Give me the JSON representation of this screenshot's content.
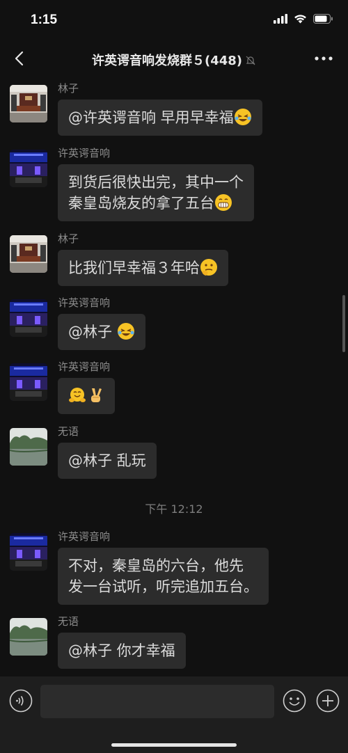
{
  "status_bar": {
    "time": "1:15"
  },
  "nav": {
    "title": "许英谔音响发烧群５(448)"
  },
  "messages": [
    {
      "sender": "林子",
      "text": "@许英谔音响 早用早幸福",
      "emoji": "laughing-tears"
    },
    {
      "sender": "许英谔音响",
      "text": "到货后很快出完，其中一个\n秦皇岛烧友的拿了五台",
      "emoji": "grin"
    },
    {
      "sender": "林子",
      "text": "比我们早幸福３年哈",
      "emoji": "thinking"
    },
    {
      "sender": "许英谔音响",
      "text": "@林子 ",
      "emoji": "laughing-tears"
    },
    {
      "sender": "许英谔音响",
      "text": "",
      "emoji": "hug-victory"
    },
    {
      "sender": "无语",
      "text": "@林子 乱玩",
      "emoji": ""
    },
    {
      "sender": "许英谔音响",
      "text": "不对，秦皇岛的六台，他先\n发一台试听，听完追加五台。",
      "emoji": ""
    },
    {
      "sender": "无语",
      "text": "@林子 你才幸福",
      "emoji": ""
    }
  ],
  "time_divider": "下午 12:12",
  "input": {
    "placeholder": ""
  },
  "colors": {
    "background": "#111111",
    "bubble": "#2c2c2c",
    "sender": "#8b8b8b"
  }
}
